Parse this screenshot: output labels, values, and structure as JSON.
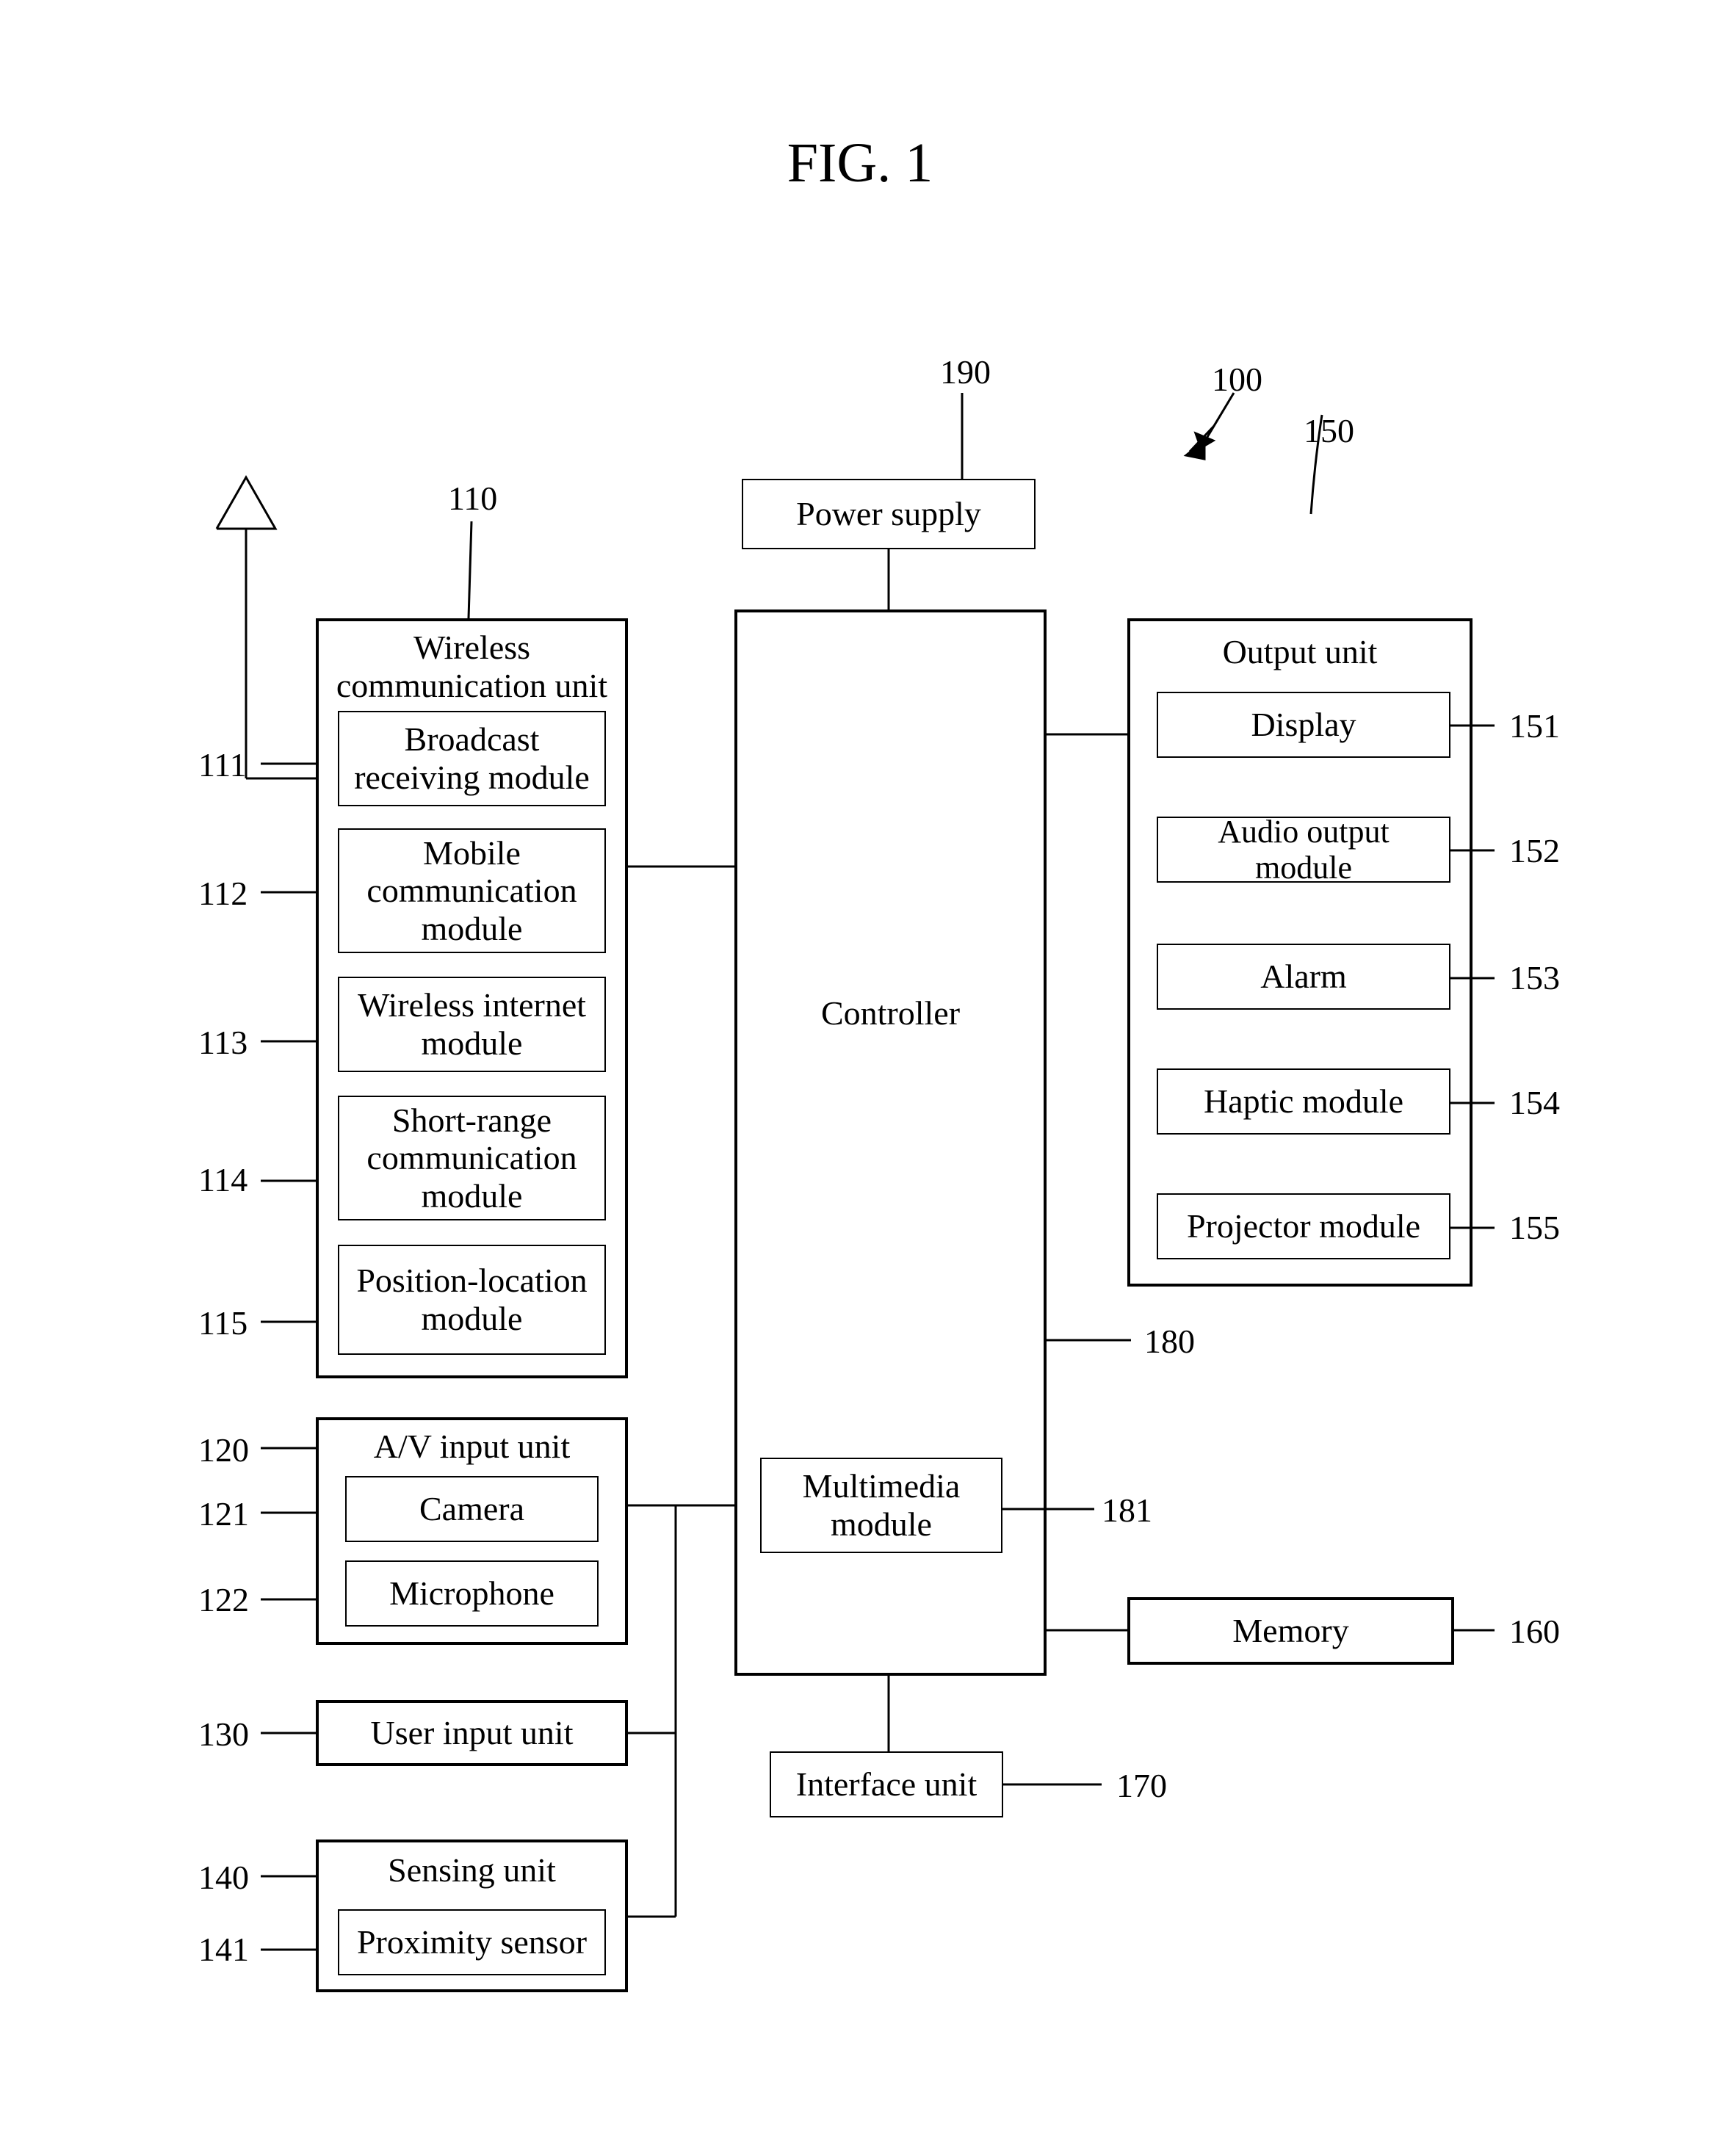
{
  "figure": {
    "title": "FIG. 1"
  },
  "refs": {
    "overall": "100",
    "power": "190",
    "wcu": "110",
    "wcu_broadcast": "111",
    "wcu_mobile": "112",
    "wcu_winternet": "113",
    "wcu_short": "114",
    "wcu_pos": "115",
    "av": "120",
    "camera": "121",
    "mic": "122",
    "uinput": "130",
    "sensing": "140",
    "prox": "141",
    "output": "150",
    "display": "151",
    "audio": "152",
    "alarm": "153",
    "haptic": "154",
    "projector": "155",
    "memory": "160",
    "iface": "170",
    "controller": "180",
    "multimedia": "181"
  },
  "labels": {
    "power": "Power supply",
    "wcu_title1": "Wireless",
    "wcu_title2": "communication unit",
    "wcu_broadcast": "Broadcast receiving module",
    "wcu_mobile": "Mobile communication module",
    "wcu_winternet": "Wireless internet module",
    "wcu_short": "Short-range communication module",
    "wcu_pos": "Position-location module",
    "av_title": "A/V input unit",
    "camera": "Camera",
    "mic": "Microphone",
    "uinput": "User input unit",
    "sensing_title": "Sensing unit",
    "prox": "Proximity sensor",
    "controller": "Controller",
    "multimedia": "Multimedia module",
    "iface": "Interface unit",
    "output_title": "Output unit",
    "display": "Display",
    "audio": "Audio output module",
    "alarm": "Alarm",
    "haptic": "Haptic module",
    "projector": "Projector module",
    "memory": "Memory"
  }
}
